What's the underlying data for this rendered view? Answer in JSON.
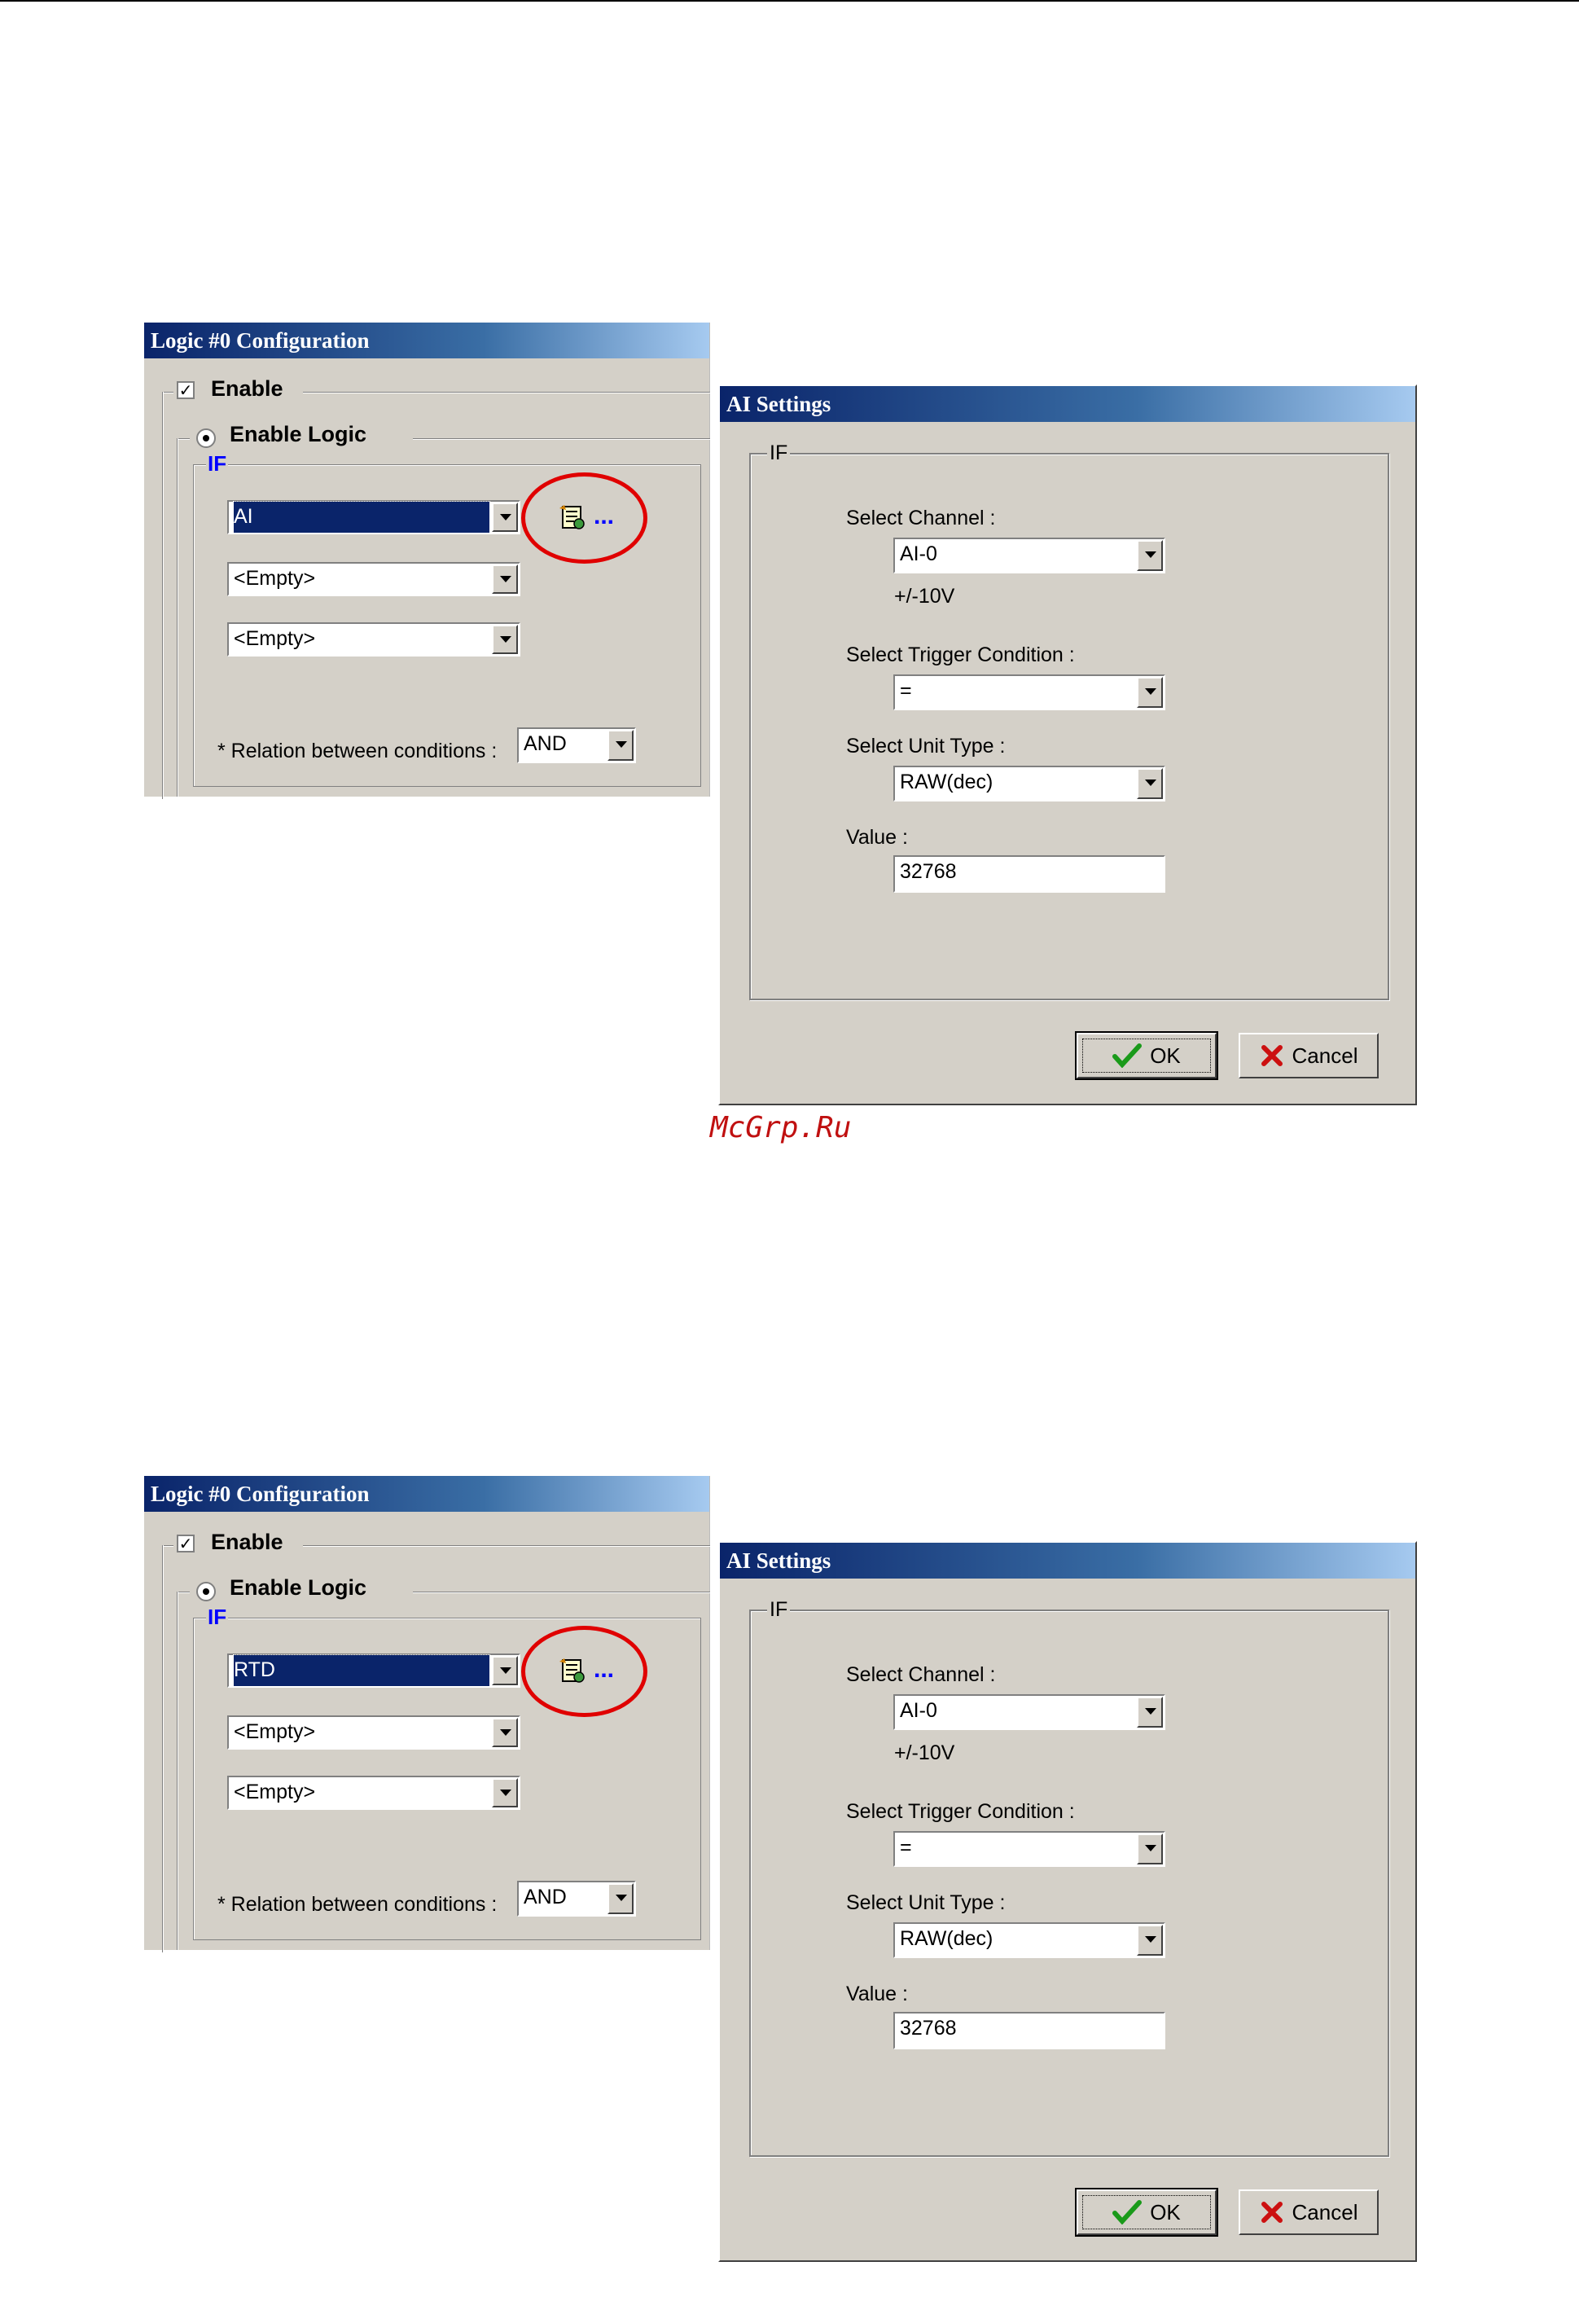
{
  "watermark": "McGrp.Ru",
  "screens": [
    {
      "logic": {
        "title": "Logic #0 Configuration",
        "enable_label": "Enable",
        "enable_checked": true,
        "enable_logic_label": "Enable Logic",
        "if_label": "IF",
        "conditions": [
          "AI",
          "<Empty>",
          "<Empty>"
        ],
        "condition_button_text": "...",
        "relation_label": "* Relation between conditions :",
        "relation_value": "AND"
      },
      "ai": {
        "title": "AI Settings",
        "if_label": "IF",
        "channel_label": "Select Channel :",
        "channel_value": "AI-0",
        "range_text": "+/-10V",
        "trigger_label": "Select Trigger Condition :",
        "trigger_value": "=",
        "unit_label": "Select Unit Type :",
        "unit_value": "RAW(dec)",
        "value_label": "Value :",
        "value": "32768",
        "ok_label": "OK",
        "cancel_label": "Cancel"
      }
    },
    {
      "logic": {
        "title": "Logic #0 Configuration",
        "enable_label": "Enable",
        "enable_checked": true,
        "enable_logic_label": "Enable Logic",
        "if_label": "IF",
        "conditions": [
          "RTD",
          "<Empty>",
          "<Empty>"
        ],
        "condition_button_text": "...",
        "relation_label": "* Relation between conditions :",
        "relation_value": "AND"
      },
      "ai": {
        "title": "AI Settings",
        "if_label": "IF",
        "channel_label": "Select Channel :",
        "channel_value": "AI-0",
        "range_text": "+/-10V",
        "trigger_label": "Select Trigger Condition :",
        "trigger_value": "=",
        "unit_label": "Select Unit Type :",
        "unit_value": "RAW(dec)",
        "value_label": "Value :",
        "value": "32768",
        "ok_label": "OK",
        "cancel_label": "Cancel"
      }
    }
  ]
}
